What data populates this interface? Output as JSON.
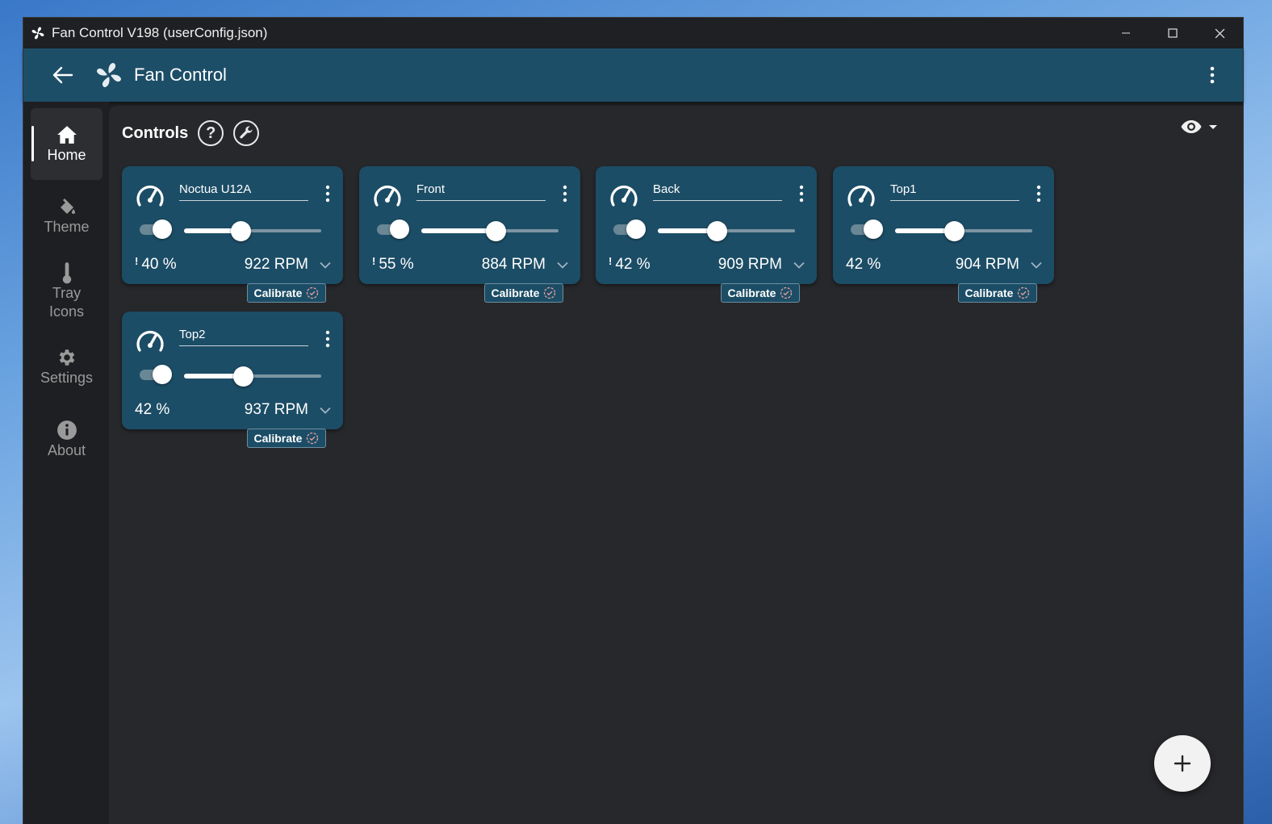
{
  "window": {
    "title": "Fan Control V198 (userConfig.json)"
  },
  "appbar": {
    "title": "Fan Control"
  },
  "sidebar": {
    "items": [
      {
        "label": "Home",
        "icon": "home-icon",
        "active": true
      },
      {
        "label": "Theme",
        "icon": "paint-bucket-icon"
      },
      {
        "label": "Tray\nIcons",
        "icon": "thermometer-icon"
      },
      {
        "label": "Settings",
        "icon": "gear-icon"
      },
      {
        "label": "About",
        "icon": "info-icon"
      }
    ]
  },
  "controls": {
    "heading": "Controls",
    "help_label": "?",
    "calibrate_label": "Calibrate",
    "cards": [
      {
        "name": "Noctua U12A",
        "percent": "40 %",
        "rpm": "922 RPM",
        "warning": true,
        "level": 0.41
      },
      {
        "name": "Front",
        "percent": "55 %",
        "rpm": "884 RPM",
        "warning": true,
        "level": 0.54
      },
      {
        "name": "Back",
        "percent": "42 %",
        "rpm": "909 RPM",
        "warning": true,
        "level": 0.43
      },
      {
        "name": "Top1",
        "percent": "42 %",
        "rpm": "904 RPM",
        "warning": false,
        "level": 0.43
      },
      {
        "name": "Top2",
        "percent": "42 %",
        "rpm": "937 RPM",
        "warning": false,
        "level": 0.43
      }
    ]
  },
  "fab": {
    "label": "+"
  },
  "colors": {
    "accent": "#1c4d66",
    "appbar": "#1d4e68",
    "background": "#27282b"
  }
}
